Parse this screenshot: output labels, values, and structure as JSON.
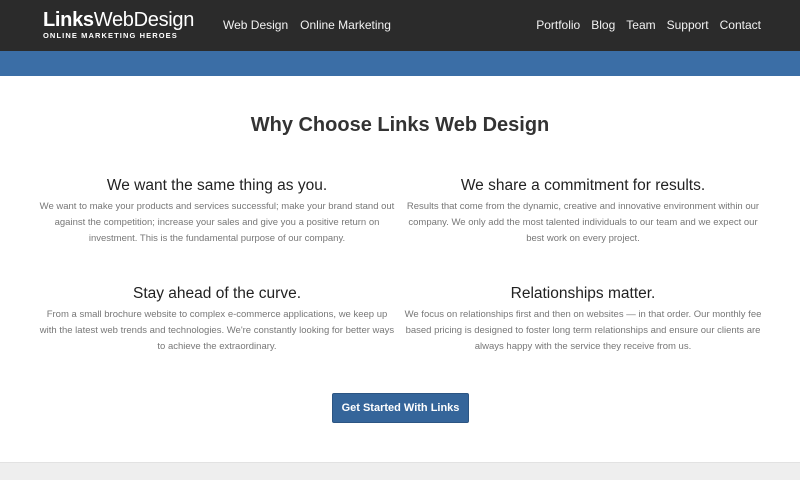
{
  "logo": {
    "bold": "Links",
    "thin": "WebDesign",
    "tagline": "ONLINE MARKETING HEROES"
  },
  "nav_left": [
    {
      "label": "Web Design"
    },
    {
      "label": "Online Marketing"
    }
  ],
  "nav_right": [
    {
      "label": "Portfolio"
    },
    {
      "label": "Blog"
    },
    {
      "label": "Team"
    },
    {
      "label": "Support"
    },
    {
      "label": "Contact"
    }
  ],
  "section": {
    "title": "Why Choose Links Web Design"
  },
  "features": [
    {
      "title": "We want the same thing as you.",
      "text": "We want to make your products and services successful; make your brand stand out against the competition; increase your sales and give you a positive return on investment. This is the fundamental purpose of our company."
    },
    {
      "title": "We share a commitment for results.",
      "text": "Results that come from the dynamic, creative and innovative environment within our company. We only add the most talented individuals to our team and we expect our best work on every project."
    },
    {
      "title": "Stay ahead of the curve.",
      "text": "From a small brochure website to complex e-commerce applications, we keep up with the latest web trends and technologies. We're constantly looking for better ways to achieve the extraordinary."
    },
    {
      "title": "Relationships matter.",
      "text": "We focus on relationships first and then on websites — in that order. Our monthly fee based pricing is designed to foster long term relationships and ensure our clients are always happy with the service they receive from us."
    }
  ],
  "cta": {
    "label": "Get Started With Links"
  },
  "colors": {
    "navbar": "#2b2b2b",
    "accent_bar": "#3b6ea6",
    "button": "#35659a"
  }
}
